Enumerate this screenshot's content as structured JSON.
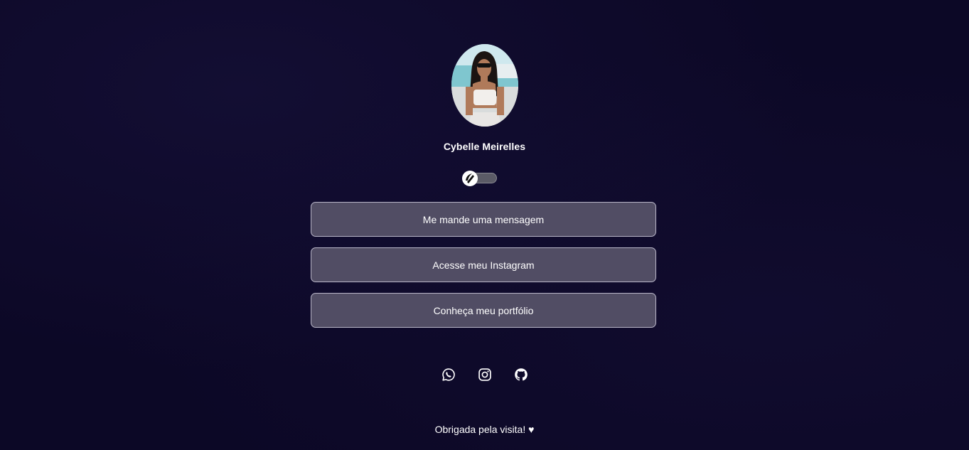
{
  "profile": {
    "name": "Cybelle Meirelles"
  },
  "theme_toggle": {
    "state": "dark"
  },
  "links": [
    {
      "label": "Me mande uma mensagem"
    },
    {
      "label": "Acesse meu Instagram"
    },
    {
      "label": "Conheça meu portfólio"
    }
  ],
  "socials": [
    {
      "icon": "whatsapp-icon"
    },
    {
      "icon": "instagram-icon"
    },
    {
      "icon": "github-icon"
    }
  ],
  "footer": {
    "text": "Obrigada pela visita! ♥"
  },
  "colors": {
    "background": "#0c0826",
    "button": "#514d64",
    "button_border": "#b9b6c8",
    "text": "#ffffff"
  }
}
